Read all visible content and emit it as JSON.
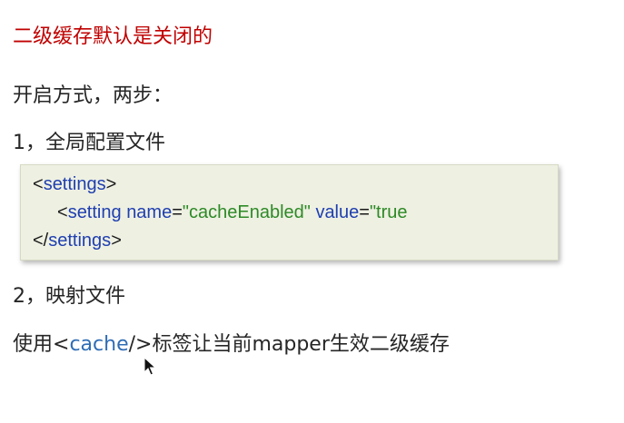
{
  "title": "二级缓存默认是关闭的",
  "line1": "开启方式，两步：",
  "step1": "1，全局配置文件",
  "code": {
    "l1_open": "<",
    "l1_tag": "settings",
    "l1_close": ">",
    "l2_open": "<",
    "l2_tag": "setting",
    "l2_attr1": "name",
    "l2_eq1": "=",
    "l2_val1": "\"cacheEnabled\"",
    "l2_attr2": "value",
    "l2_eq2": "=",
    "l2_val2": "\"true",
    "l3_open": "</",
    "l3_tag": "settings",
    "l3_close": ">"
  },
  "step2": "2，映射文件",
  "line4": {
    "prefix": "使用",
    "open": "<",
    "code": "cache",
    "close": "/>",
    "suffix": "标签让当前mapper生效二级缓存"
  },
  "colors": {
    "title": "#c00000",
    "code_background": "#eef0e2",
    "tag": "#1f3fb0",
    "value": "#2d8a26",
    "inline_code": "#2f6db5"
  },
  "icons": {
    "cursor": "mouse-pointer-icon"
  }
}
